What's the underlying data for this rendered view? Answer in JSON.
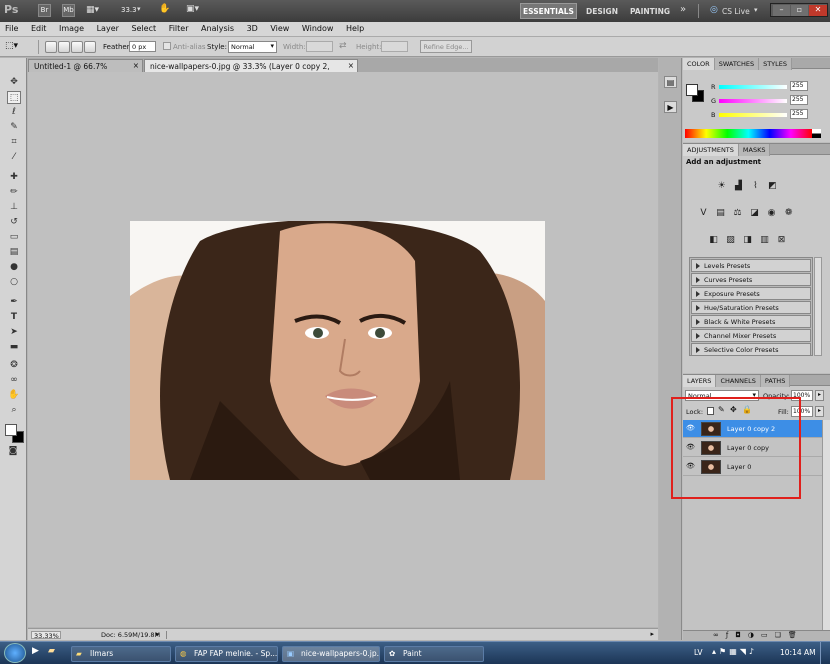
{
  "appbar": {
    "logo": "Ps",
    "br": "Br",
    "mb": "Mb",
    "zoom": "33.3",
    "workspaces": [
      "ESSENTIALS",
      "DESIGN",
      "PAINTING"
    ],
    "more": "»",
    "cslive": "CS Live"
  },
  "menu": [
    "File",
    "Edit",
    "Image",
    "Layer",
    "Select",
    "Filter",
    "Analysis",
    "3D",
    "View",
    "Window",
    "Help"
  ],
  "options": {
    "feather_label": "Feather:",
    "feather_value": "0 px",
    "antialias_label": "Anti-alias",
    "style_label": "Style:",
    "style_value": "Normal",
    "width_label": "Width:",
    "height_label": "Height:",
    "refine_label": "Refine Edge..."
  },
  "doctabs": [
    {
      "title": "Untitled-1 @ 66.7% (RGB/8)",
      "close": "×"
    },
    {
      "title": "nice-wallpapers-0.jpg @ 33.3% (Layer 0 copy 2, RGB/8#) *",
      "close": "×"
    }
  ],
  "status": {
    "zoom": "33.33%",
    "doc": "Doc: 6.59M/19.8M"
  },
  "color_panel": {
    "tabs": [
      "COLOR",
      "SWATCHES",
      "STYLES"
    ],
    "channels": [
      {
        "label": "R",
        "value": "255"
      },
      {
        "label": "G",
        "value": "255"
      },
      {
        "label": "B",
        "value": "255"
      }
    ]
  },
  "adjustments": {
    "tabs": [
      "ADJUSTMENTS",
      "MASKS"
    ],
    "title": "Add an adjustment",
    "presets": [
      "Levels Presets",
      "Curves Presets",
      "Exposure Presets",
      "Hue/Saturation Presets",
      "Black & White Presets",
      "Channel Mixer Presets",
      "Selective Color Presets"
    ]
  },
  "layers_panel": {
    "tabs": [
      "LAYERS",
      "CHANNELS",
      "PATHS"
    ],
    "blend_mode": "Normal",
    "opacity_label": "Opacity:",
    "opacity_value": "100%",
    "lock_label": "Lock:",
    "fill_label": "Fill:",
    "fill_value": "100%",
    "layers": [
      {
        "name": "Layer 0 copy 2",
        "selected": true
      },
      {
        "name": "Layer 0 copy",
        "selected": false
      },
      {
        "name": "Layer 0",
        "selected": false
      }
    ]
  },
  "taskbar": {
    "items": [
      "Ilmars",
      "FAP FAP melnie. - Sp...",
      "nice-wallpapers-0.jp...",
      "Paint"
    ],
    "lang": "LV",
    "time": "10:14 AM"
  },
  "colors": {
    "highlight": "#3d8ee6",
    "annotation": "#e0201c",
    "taskbar": "#1c3556"
  }
}
